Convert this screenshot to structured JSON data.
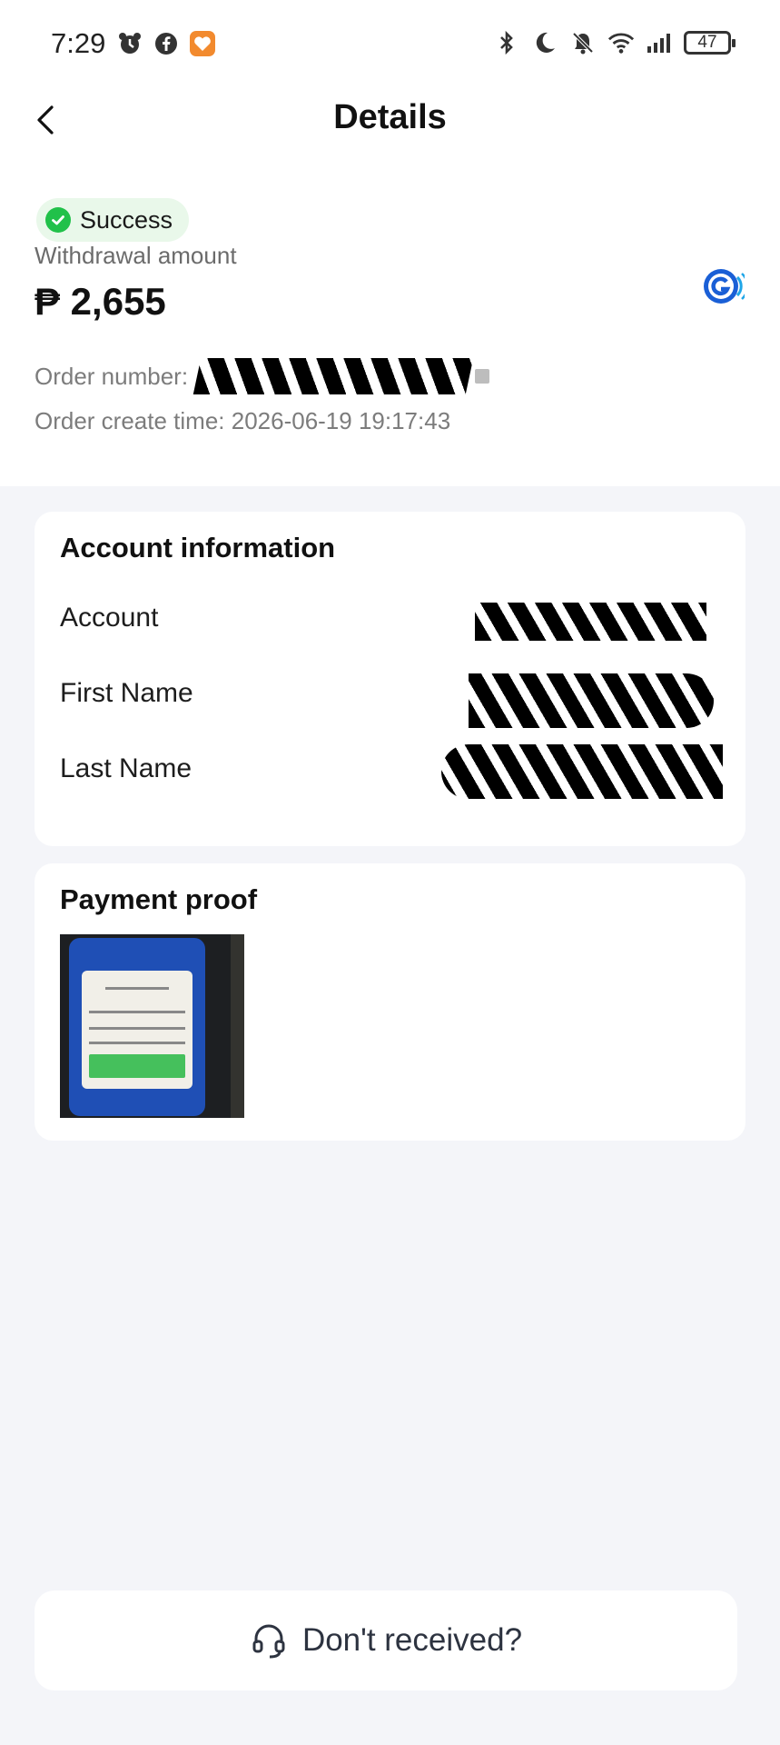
{
  "status_bar": {
    "time": "7:29",
    "battery": "47",
    "left_icons": [
      "alarm-icon",
      "facebook-icon",
      "heart-app-icon"
    ],
    "right_icons": [
      "bluetooth-icon",
      "moon-icon",
      "bell-off-icon",
      "wifi-icon",
      "signal-icon",
      "battery-icon"
    ]
  },
  "header": {
    "title": "Details",
    "back_icon": "chevron-left-icon"
  },
  "summary": {
    "status": "Success",
    "status_color": "#21c14a",
    "withdraw_label": "Withdrawal amount",
    "amount": "₱ 2,655",
    "order_number_label": "Order number:",
    "order_create_time": "Order create time: 2026-06-19 19:17:43"
  },
  "account_info": {
    "title": "Account information",
    "fields": [
      {
        "label": "Account"
      },
      {
        "label": "First Name"
      },
      {
        "label": "Last Name"
      }
    ]
  },
  "payment_proof": {
    "title": "Payment proof"
  },
  "bottom": {
    "button_label": "Don't received?",
    "icon": "headset-icon"
  }
}
